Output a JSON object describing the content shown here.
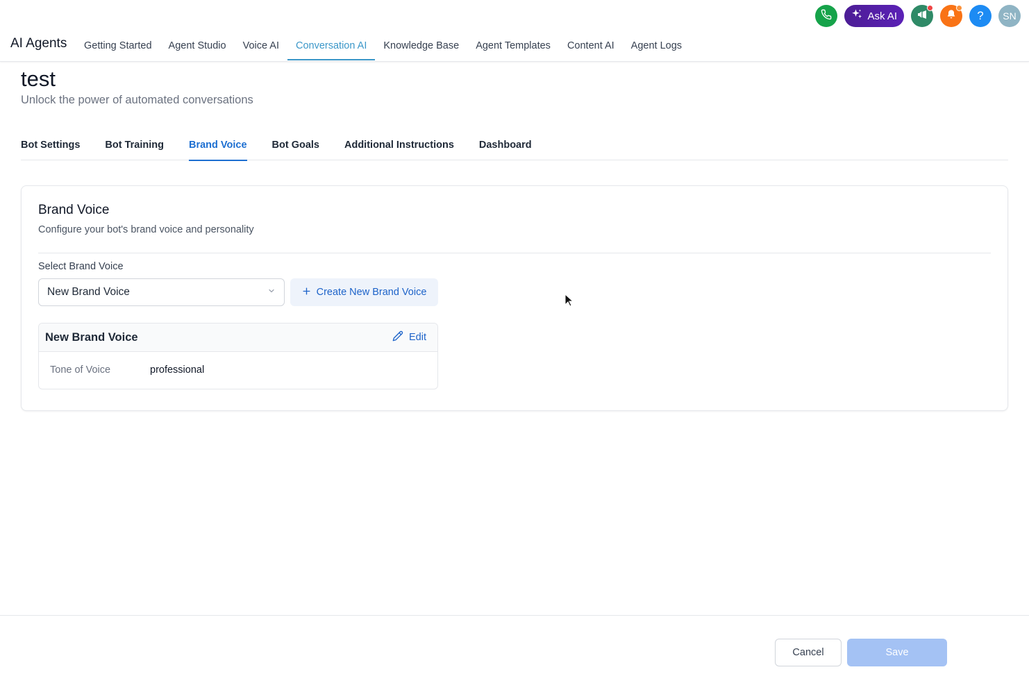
{
  "header": {
    "app_title": "AI Agents",
    "nav": [
      {
        "label": "Getting Started"
      },
      {
        "label": "Agent Studio"
      },
      {
        "label": "Voice AI"
      },
      {
        "label": "Conversation AI",
        "active": true
      },
      {
        "label": "Knowledge Base"
      },
      {
        "label": "Agent Templates"
      },
      {
        "label": "Content AI"
      },
      {
        "label": "Agent Logs"
      }
    ],
    "actions": {
      "phone_icon": "phone-icon",
      "ask_ai_label": "Ask AI",
      "ask_ai_icon": "sparkles-icon",
      "announcement_icon": "megaphone-icon",
      "notification_icon": "bell-icon",
      "help_label": "?",
      "avatar_initials": "SN"
    }
  },
  "page": {
    "title": "test",
    "subtitle": "Unlock the power of automated conversations"
  },
  "tabs": [
    {
      "label": "Bot Settings"
    },
    {
      "label": "Bot Training"
    },
    {
      "label": "Brand Voice",
      "active": true
    },
    {
      "label": "Bot Goals"
    },
    {
      "label": "Additional Instructions"
    },
    {
      "label": "Dashboard"
    }
  ],
  "brand_voice": {
    "title": "Brand Voice",
    "subtitle": "Configure your bot's brand voice and personality",
    "select_label": "Select Brand Voice",
    "selected_value": "New Brand Voice",
    "create_button_label": "Create New Brand Voice",
    "detail": {
      "name": "New Brand Voice",
      "edit_label": "Edit",
      "rows": [
        {
          "key": "Tone of Voice",
          "value": "professional"
        }
      ]
    }
  },
  "footer": {
    "cancel_label": "Cancel",
    "save_label": "Save"
  },
  "colors": {
    "primary": "#1d63c9",
    "nav_active": "#3b97c9",
    "save_disabled": "#a4c2f4",
    "ask_ai": "#4c1d95"
  }
}
